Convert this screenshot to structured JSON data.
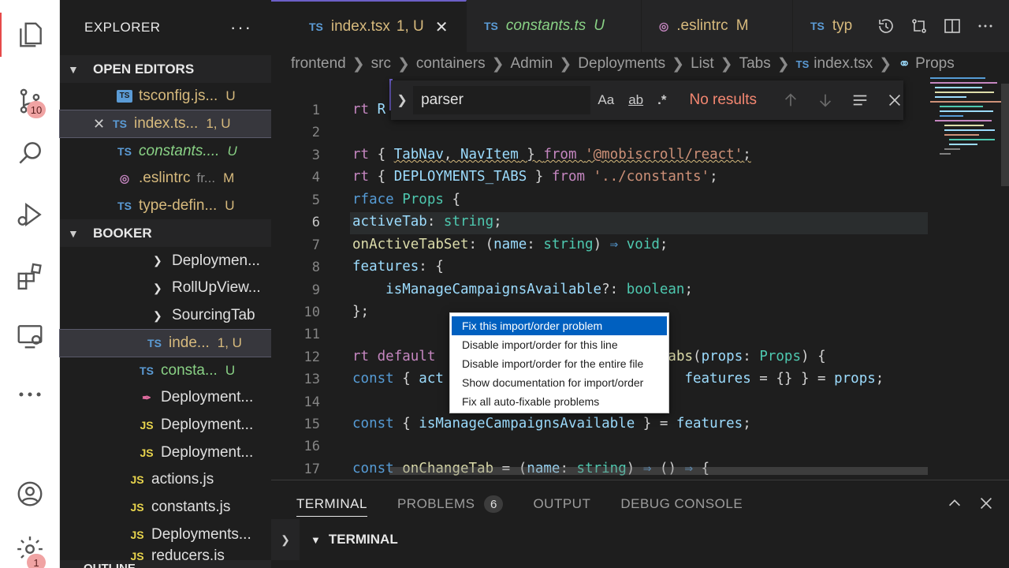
{
  "activity": {
    "scm_badge": "10",
    "settings_badge": "1"
  },
  "sidebar": {
    "title": "EXPLORER",
    "open_editors_label": "OPEN EDITORS",
    "open_editors": [
      {
        "icon": "TS",
        "name": "tsconfig.js...",
        "status": "U"
      },
      {
        "icon": "TS",
        "name": "index.ts...",
        "status": "1, U"
      },
      {
        "icon": "TS",
        "name": "constants....",
        "status": "U"
      },
      {
        "icon": "eslint",
        "name": ".eslintrc",
        "extra": "fr...",
        "status": "M"
      },
      {
        "icon": "TS",
        "name": "type-defin...",
        "status": "U"
      }
    ],
    "booker_label": "BOOKER",
    "tree": [
      {
        "kind": "folder",
        "name": "Deploymen..."
      },
      {
        "kind": "folder",
        "name": "RollUpView..."
      },
      {
        "kind": "folder",
        "name": "SourcingTab"
      },
      {
        "icon": "TS",
        "name": "inde...",
        "status": "1, U"
      },
      {
        "icon": "TS",
        "name": "consta...",
        "status": "U"
      },
      {
        "icon": "style",
        "name": "Deployment..."
      },
      {
        "icon": "JS",
        "name": "Deployment..."
      },
      {
        "icon": "JS",
        "name": "Deployment..."
      },
      {
        "icon": "JS",
        "name": "actions.js"
      },
      {
        "icon": "JS",
        "name": "constants.js"
      },
      {
        "icon": "JS",
        "name": "Deployments..."
      },
      {
        "icon": "JS",
        "name": "reducers.js"
      }
    ],
    "outline_label": "OUTLINE"
  },
  "tabs": [
    {
      "icon": "TS",
      "name": "index.tsx",
      "status": "1, U",
      "active": true
    },
    {
      "icon": "TS",
      "name": "constants.ts",
      "status": "U"
    },
    {
      "icon": "eslint",
      "name": ".eslintrc",
      "status": "M"
    },
    {
      "icon": "TS",
      "name": "typ"
    }
  ],
  "breadcrumbs": [
    "frontend",
    "src",
    "containers",
    "Admin",
    "Deployments",
    "List",
    "Tabs",
    "index.tsx",
    "Props"
  ],
  "find": {
    "query": "parser",
    "case_label": "Aa",
    "word_label": "ab",
    "regex_label": ".*",
    "result": "No results"
  },
  "editor": {
    "lines": [
      "1",
      "2",
      "3",
      "4",
      "5",
      "6",
      "7",
      "8",
      "9",
      "10",
      "11",
      "12",
      "13",
      "14",
      "15",
      "16",
      "17"
    ],
    "current_line": "6"
  },
  "quickfix": [
    "Fix this import/order problem",
    "Disable import/order for this line",
    "Disable import/order for the entire file",
    "Show documentation for import/order",
    "Fix all auto-fixable problems"
  ],
  "panel": {
    "tabs": [
      "TERMINAL",
      "PROBLEMS",
      "OUTPUT",
      "DEBUG CONSOLE"
    ],
    "problems_count": "6",
    "terminal_label": "TERMINAL"
  }
}
